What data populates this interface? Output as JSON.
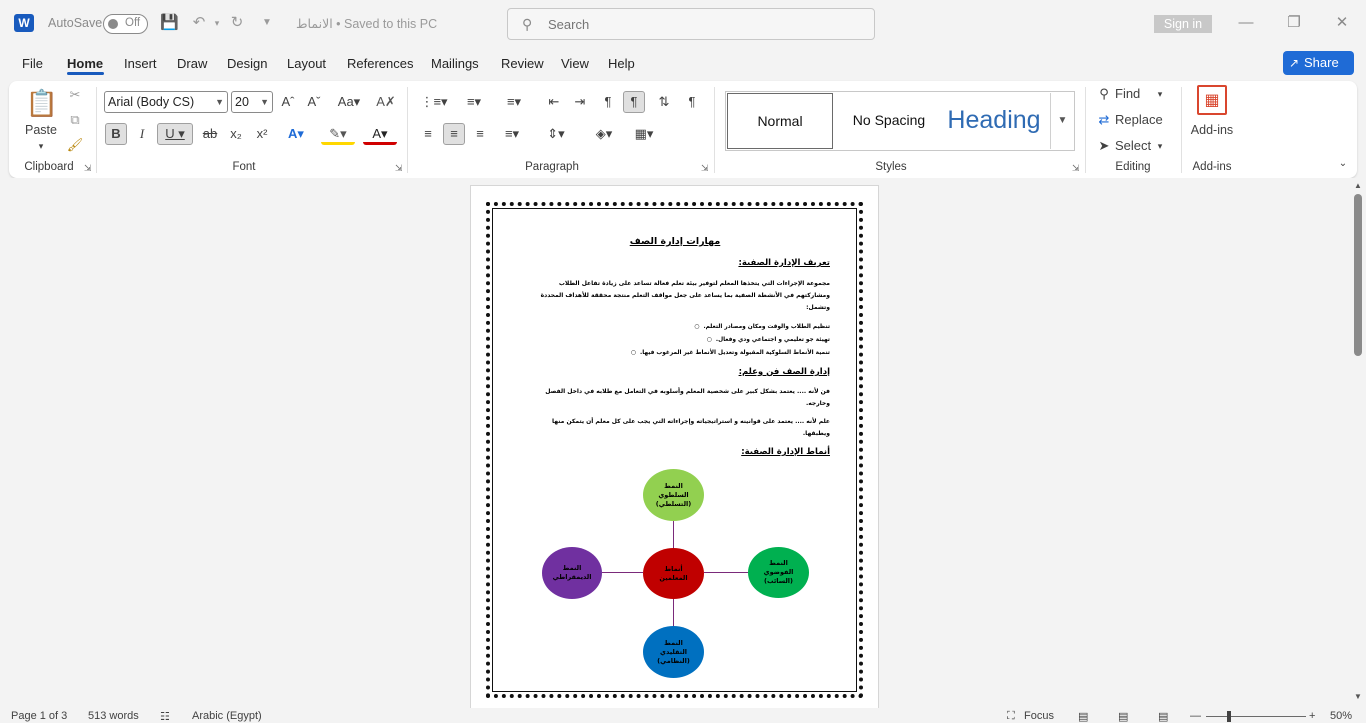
{
  "titlebar": {
    "app_icon_letter": "W",
    "autosave_label": "AutoSave",
    "autosave_state": "Off",
    "document_title": "الانماط • Saved to this PC",
    "search_placeholder": "Search",
    "sign_in": "Sign in"
  },
  "menu": {
    "items": [
      "File",
      "Home",
      "Insert",
      "Draw",
      "Design",
      "Layout",
      "References",
      "Mailings",
      "Review",
      "View",
      "Help"
    ],
    "active": "Home",
    "share": "Share"
  },
  "ribbon": {
    "clipboard": {
      "label": "Clipboard",
      "paste": "Paste"
    },
    "font": {
      "label": "Font",
      "font_name": "Arial (Body CS)",
      "font_size": "20"
    },
    "paragraph": {
      "label": "Paragraph"
    },
    "styles": {
      "label": "Styles",
      "normal": "Normal",
      "no_spacing": "No Spacing",
      "heading": "Heading"
    },
    "editing": {
      "label": "Editing",
      "find": "Find",
      "replace": "Replace",
      "select": "Select"
    },
    "addins": {
      "label": "Add-ins",
      "button": "Add-ins"
    }
  },
  "document": {
    "title": "مهارات إدارة الصف",
    "h1": "تعريف الإدارة الصفية:",
    "p1": "مجموعة الإجراءات التي يتخذها المعلم لتوفير بيئة تعلم فعالة تساعد على زيادة تفاعل الطلاب ومشاركتهم في الأنشطة الصفية بما يساعد على جعل مواقف التعلم منتجة محققة للأهداف المحددة وتشمل:",
    "list": [
      "تنظيم الطلاب والوقت ومكان ومصادر التعلم.",
      "تهيئة جو تعليمي و اجتماعي ودي وفعال.",
      "تنمية الأنماط السلوكية المقبولة وتعديل الأنماط غير المرغوب فيها."
    ],
    "h2": "إدارة الصف فن وعلم:",
    "p2": "فن لأنه .... يعتمد بشكل كبير على شخصية المعلم وأسلوبه في التعامل مع طلابه في داخل الفصل وخارجه.",
    "p3": "علم لأنه .... يعتمد على قوانينه و استراتيجياته وإجراءاته التي يجب على كل معلم أن يتمكن منها ويطبقها.",
    "h3": "أنماط الإدارة الصفية:",
    "diagram": {
      "center": "أنماط المعلمين",
      "top": "النمط السلطوي (التسلطي)",
      "left": "النمط الديمقراطي",
      "right": "النمط الفوضوي (السائب)",
      "bottom": "النمط التقليدي (النظامي)",
      "colors": {
        "center": "#c00000",
        "top": "#92d050",
        "left": "#7030a0",
        "right": "#00b050",
        "bottom": "#0070c0"
      }
    }
  },
  "status": {
    "page": "Page 1 of 3",
    "words": "513 words",
    "language": "Arabic (Egypt)",
    "focus": "Focus",
    "zoom": "50%"
  }
}
